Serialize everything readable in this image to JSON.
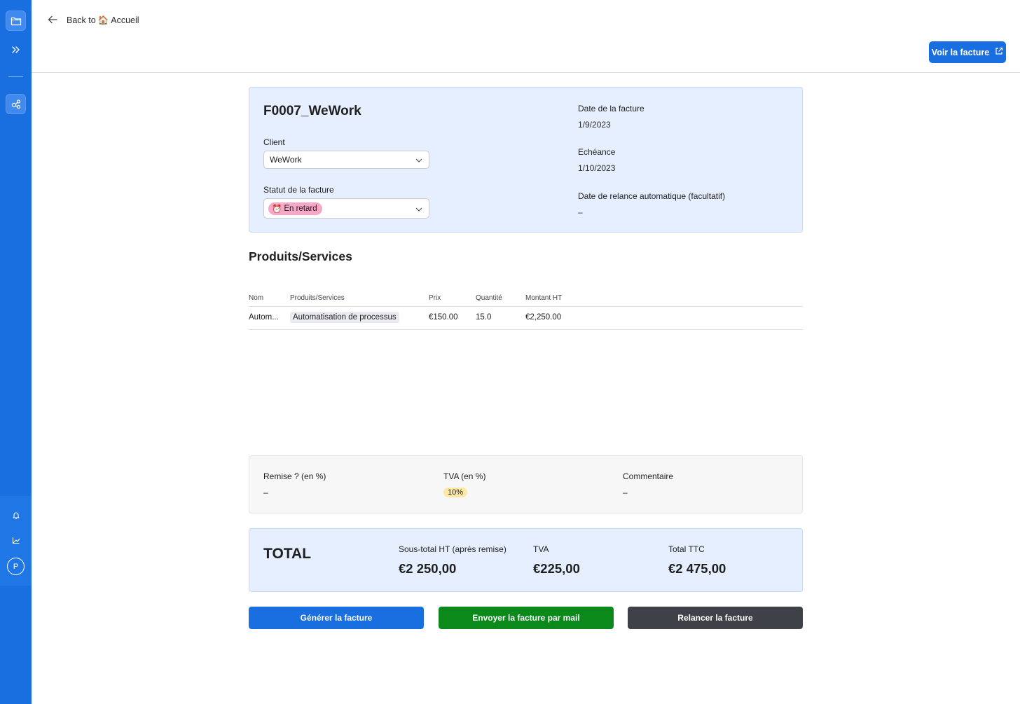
{
  "colors": {
    "sidebar": "#1a6fe0",
    "primary_button": "#1a6fe0",
    "mail_button": "#0b8a1b",
    "reminder_button": "#3e4147",
    "card_bg": "#e6efff",
    "late_tag": "#f6a8c6",
    "tva_tag": "#fde8a6"
  },
  "sidebar": {
    "icons": [
      "folder-icon",
      "expand-icon",
      "integrations-icon",
      "bell-icon",
      "share-icon"
    ],
    "avatar_initial": "P"
  },
  "header": {
    "back_label": "Back to",
    "back_icon_emoji": "🏠",
    "back_target": "Accueil",
    "view_invoice_label": "Voir la facture"
  },
  "invoice": {
    "title": "F0007_WeWork",
    "client_label": "Client",
    "client_value": "WeWork",
    "status_label": "Statut de la facture",
    "status_emoji": "⏰",
    "status_value": "En retard",
    "invoice_date_label": "Date de la facture",
    "invoice_date": "1/9/2023",
    "due_label": "Echéance",
    "due_date": "1/10/2023",
    "reminder_label": "Date de relance automatique (facultatif)",
    "reminder_value": "–"
  },
  "products": {
    "title": "Produits/Services",
    "columns": [
      "Nom",
      "Produits/Services",
      "Prix",
      "Quantité",
      "Montant HT"
    ],
    "rows": [
      {
        "nom": "Autom...",
        "produit": "Automatisation de processus",
        "prix": "€150.00",
        "quantite": "15.0",
        "montant": "€2,250.00"
      }
    ]
  },
  "extras": {
    "remise_label": "Remise ? (en %)",
    "remise_value": "–",
    "tva_label": "TVA (en %)",
    "tva_value": "10%",
    "commentaire_label": "Commentaire",
    "commentaire_value": "–"
  },
  "totals": {
    "label": "TOTAL",
    "subtotal_label": "Sous-total HT (après remise)",
    "subtotal_value": "€2 250,00",
    "tva_label": "TVA",
    "tva_value": "€225,00",
    "ttc_label": "Total TTC",
    "ttc_value": "€2 475,00"
  },
  "actions": {
    "generate": "Générer la facture",
    "send_mail": "Envoyer la facture par mail",
    "remind": "Relancer la facture"
  }
}
